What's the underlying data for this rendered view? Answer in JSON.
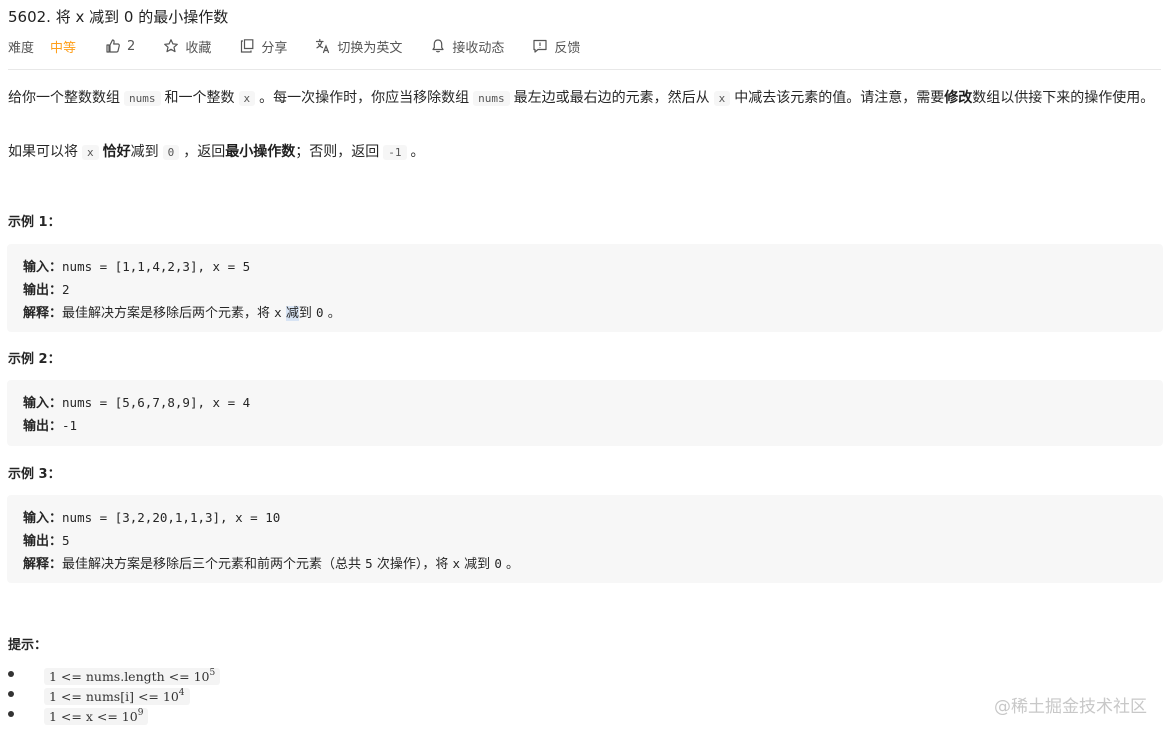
{
  "title": "5602. 将 x 减到 0 的最小操作数",
  "meta": {
    "difficulty_label": "难度",
    "difficulty": "中等",
    "likes": "2",
    "favorite": "收藏",
    "share": "分享",
    "switch_lang": "切换为英文",
    "subscribe": "接收动态",
    "feedback": "反馈"
  },
  "description": {
    "p1_a": "给你一个整数数组",
    "p1_nums": "nums",
    "p1_b": "和一个整数",
    "p1_x": "x",
    "p1_c": "。每一次操作时，你应当移除数组",
    "p1_nums2": "nums",
    "p1_d": "最左边或最右边的元素，然后从",
    "p1_x2": "x",
    "p1_e": "中减去该元素的值。请注意，需要",
    "p1_bold": "修改",
    "p1_f": "数组以供接下来的操作使用。",
    "p2_a": "如果可以将",
    "p2_x": "x",
    "p2_bold1": "恰好",
    "p2_b": "减到",
    "p2_zero": "0",
    "p2_c": "，返回",
    "p2_bold2": "最小操作数",
    "p2_d": "；否则，返回",
    "p2_neg": "-1",
    "p2_e": "。"
  },
  "labels": {
    "input": "输入：",
    "output": "输出：",
    "explain": "解释："
  },
  "examples": [
    {
      "title": "示例 1：",
      "input": "nums = [1,1,4,2,3], x = 5",
      "output": "2",
      "explain_a": "最佳解决方案是移除后两个元素，将",
      "explain_x": "x",
      "explain_hl": "减",
      "explain_b": "到",
      "explain_zero": "0",
      "explain_c": "。"
    },
    {
      "title": "示例 2：",
      "input": "nums = [5,6,7,8,9], x = 4",
      "output": "-1"
    },
    {
      "title": "示例 3：",
      "input": "nums = [3,2,20,1,1,3], x = 10",
      "output": "5",
      "explain_a": "最佳解决方案是移除后三个元素和前两个元素（总共",
      "explain_five": "5",
      "explain_b": "次操作），将",
      "explain_x": "x",
      "explain_c": "减到",
      "explain_zero": "0",
      "explain_d": "。"
    }
  ],
  "hints": {
    "title": "提示：",
    "items": [
      {
        "text": "1 <= nums.length <= 10",
        "sup": "5"
      },
      {
        "text": "1 <= nums[i] <= 10",
        "sup": "4"
      },
      {
        "text": "1 <= x <= 10",
        "sup": "9"
      }
    ]
  },
  "watermark": "@稀土掘金技术社区"
}
